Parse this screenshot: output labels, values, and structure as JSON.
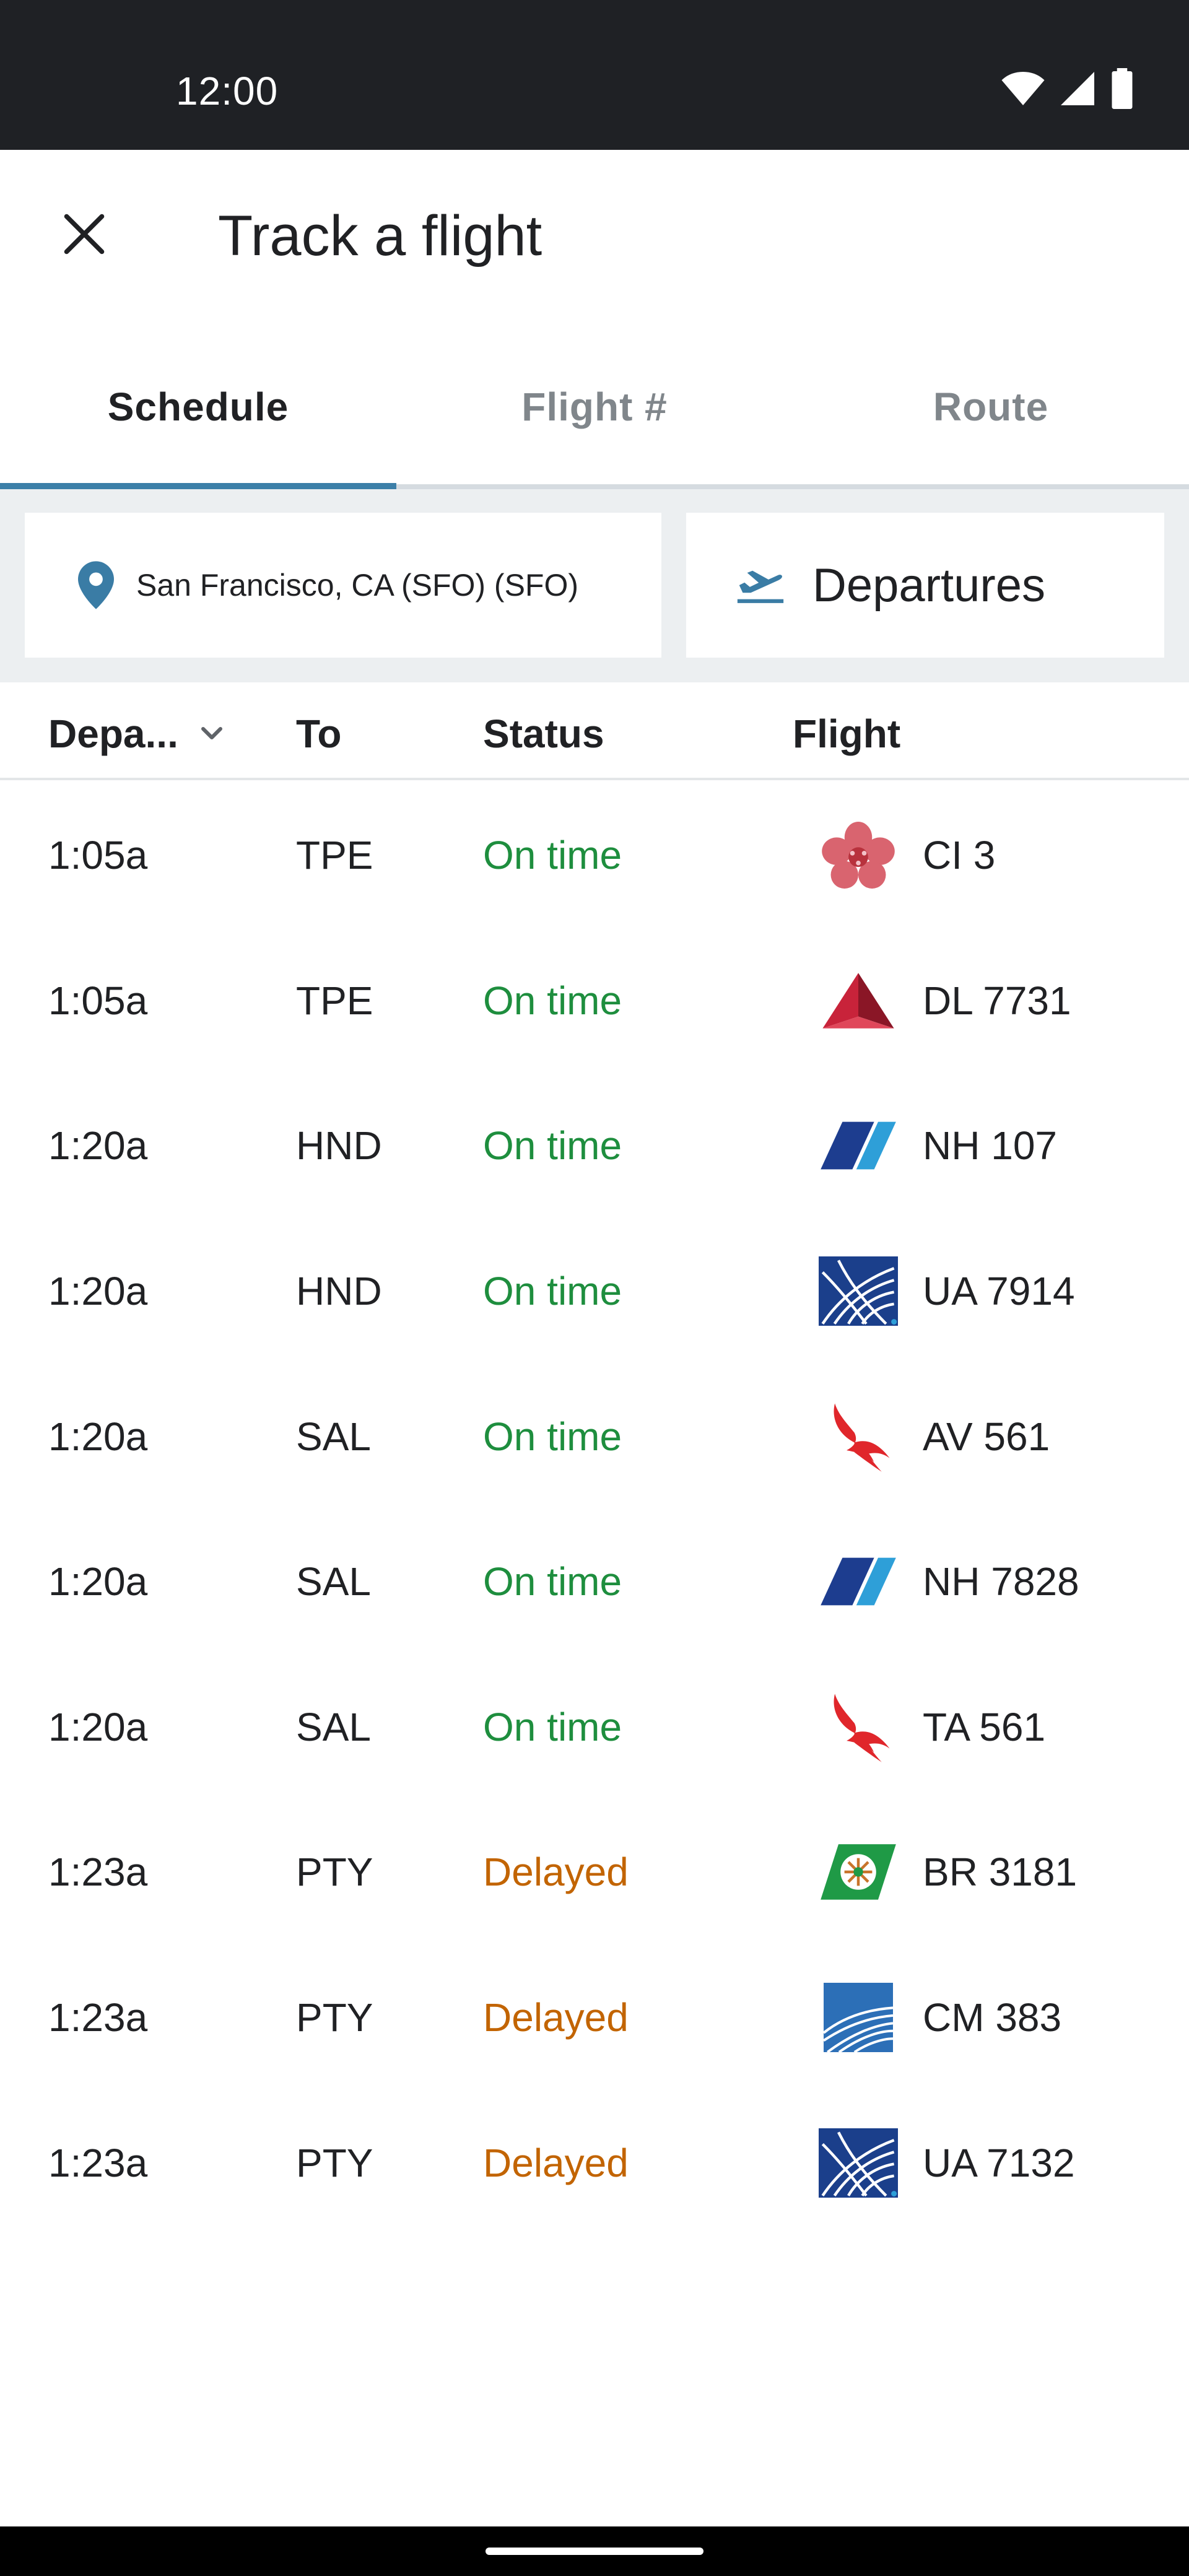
{
  "status_bar": {
    "time": "12:00",
    "icons": [
      "wifi-icon",
      "cell-signal-icon",
      "battery-icon"
    ]
  },
  "app_bar": {
    "close_icon": "close-icon",
    "title": "Track a flight"
  },
  "tabs": [
    {
      "label": "Schedule",
      "active": true
    },
    {
      "label": "Flight #",
      "active": false
    },
    {
      "label": "Route",
      "active": false
    }
  ],
  "filters": {
    "location": {
      "icon": "location-pin-icon",
      "value": "San Francisco, CA (SFO) (SFO)"
    },
    "direction": {
      "icon": "departure-plane-icon",
      "value": "Departures"
    }
  },
  "table": {
    "headers": {
      "departure": "Depa...",
      "to": "To",
      "status": "Status",
      "flight": "Flight"
    },
    "rows": [
      {
        "time": "1:05a",
        "to": "TPE",
        "status": "On time",
        "status_type": "ok",
        "airline_logo": "china-airlines-logo",
        "flight": "CI 3"
      },
      {
        "time": "1:05a",
        "to": "TPE",
        "status": "On time",
        "status_type": "ok",
        "airline_logo": "delta-logo",
        "flight": "DL 7731"
      },
      {
        "time": "1:20a",
        "to": "HND",
        "status": "On time",
        "status_type": "ok",
        "airline_logo": "ana-logo",
        "flight": "NH 107"
      },
      {
        "time": "1:20a",
        "to": "HND",
        "status": "On time",
        "status_type": "ok",
        "airline_logo": "united-logo",
        "flight": "UA 7914"
      },
      {
        "time": "1:20a",
        "to": "SAL",
        "status": "On time",
        "status_type": "ok",
        "airline_logo": "avianca-logo",
        "flight": "AV 561"
      },
      {
        "time": "1:20a",
        "to": "SAL",
        "status": "On time",
        "status_type": "ok",
        "airline_logo": "ana-logo",
        "flight": "NH 7828"
      },
      {
        "time": "1:20a",
        "to": "SAL",
        "status": "On time",
        "status_type": "ok",
        "airline_logo": "avianca-logo",
        "flight": "TA 561"
      },
      {
        "time": "1:23a",
        "to": "PTY",
        "status": "Delayed",
        "status_type": "late",
        "airline_logo": "eva-air-logo",
        "flight": "BR 3181"
      },
      {
        "time": "1:23a",
        "to": "PTY",
        "status": "Delayed",
        "status_type": "late",
        "airline_logo": "copa-logo",
        "flight": "CM 383"
      },
      {
        "time": "1:23a",
        "to": "PTY",
        "status": "Delayed",
        "status_type": "late",
        "airline_logo": "united-logo",
        "flight": "UA 7132"
      }
    ]
  },
  "colors": {
    "on_time": "#1e8e3e",
    "delayed": "#c26401",
    "accent": "#3c7fa8"
  }
}
